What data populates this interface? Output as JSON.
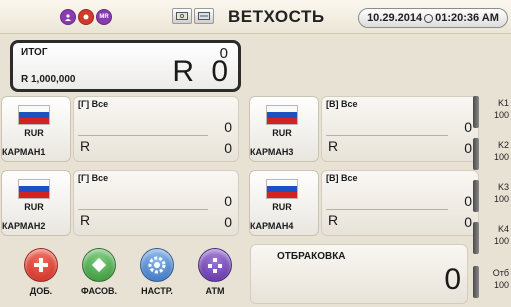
{
  "topbar": {
    "buttons": [
      {
        "name": "user-icon",
        "text": "",
        "color": "#8a3bb0"
      },
      {
        "name": "record-icon",
        "text": "",
        "color": "#d13a2a"
      },
      {
        "name": "mr-icon",
        "text": "MR",
        "color": "#8a3bb0"
      }
    ],
    "status_title": "ВЕТХОСТЬ",
    "datetime": "10.29.2014",
    "time": "01:20:36 AM"
  },
  "total": {
    "label": "ИТОГ",
    "count": "0",
    "amount": "R 1,000,000",
    "currency_symbol": "R",
    "big_value": "0"
  },
  "pockets": [
    {
      "filter": "[Г] Все",
      "currency": "RUR",
      "name": "КАРМАН1",
      "count": "0",
      "symbol": "R",
      "amount": "0"
    },
    {
      "filter": "[В] Все",
      "currency": "RUR",
      "name": "КАРМАН3",
      "count": "0",
      "symbol": "R",
      "amount": "0"
    },
    {
      "filter": "[Г] Все",
      "currency": "RUR",
      "name": "КАРМАН2",
      "count": "0",
      "symbol": "R",
      "amount": "0"
    },
    {
      "filter": "[В] Все",
      "currency": "RUR",
      "name": "КАРМАН4",
      "count": "0",
      "symbol": "R",
      "amount": "0"
    }
  ],
  "side_counters": [
    {
      "label": "K1",
      "value": "100"
    },
    {
      "label": "K2",
      "value": "100"
    },
    {
      "label": "K3",
      "value": "100"
    },
    {
      "label": "K4",
      "value": "100"
    },
    {
      "label": "Отб",
      "value": "100"
    }
  ],
  "reject": {
    "label": "ОТБРАКОВКА",
    "count": "0"
  },
  "actions": [
    {
      "label": "ДОБ.",
      "icon": "plus-icon",
      "color": "#d8362a"
    },
    {
      "label": "ФАСОВ.",
      "icon": "batch-icon",
      "color": "#3a9a3a"
    },
    {
      "label": "НАСТР.",
      "icon": "settings-icon",
      "color": "#3a78c8"
    },
    {
      "label": "АТМ",
      "icon": "atm-icon",
      "color": "#6a3aa8"
    }
  ]
}
